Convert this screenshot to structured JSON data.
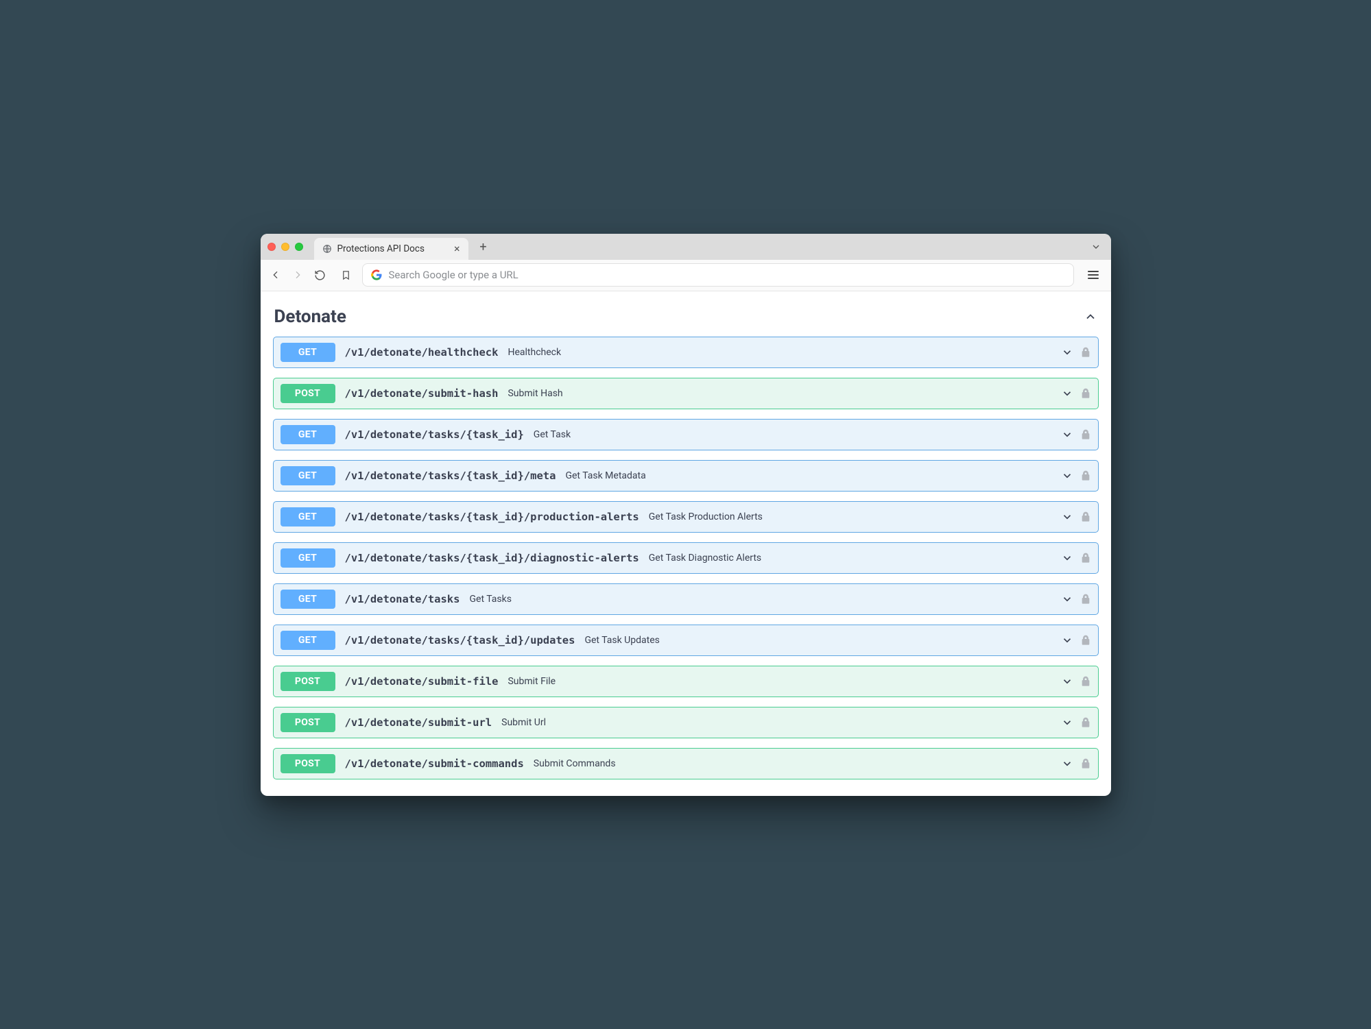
{
  "browser": {
    "tab_title": "Protections API Docs",
    "url_placeholder": "Search Google or type a URL"
  },
  "section": {
    "title": "Detonate"
  },
  "endpoints": [
    {
      "method": "GET",
      "path": "/v1/detonate/healthcheck",
      "summary": "Healthcheck"
    },
    {
      "method": "POST",
      "path": "/v1/detonate/submit-hash",
      "summary": "Submit Hash"
    },
    {
      "method": "GET",
      "path": "/v1/detonate/tasks/{task_id}",
      "summary": "Get Task"
    },
    {
      "method": "GET",
      "path": "/v1/detonate/tasks/{task_id}/meta",
      "summary": "Get Task Metadata"
    },
    {
      "method": "GET",
      "path": "/v1/detonate/tasks/{task_id}/production-alerts",
      "summary": "Get Task Production Alerts"
    },
    {
      "method": "GET",
      "path": "/v1/detonate/tasks/{task_id}/diagnostic-alerts",
      "summary": "Get Task Diagnostic Alerts"
    },
    {
      "method": "GET",
      "path": "/v1/detonate/tasks",
      "summary": "Get Tasks"
    },
    {
      "method": "GET",
      "path": "/v1/detonate/tasks/{task_id}/updates",
      "summary": "Get Task Updates"
    },
    {
      "method": "POST",
      "path": "/v1/detonate/submit-file",
      "summary": "Submit File"
    },
    {
      "method": "POST",
      "path": "/v1/detonate/submit-url",
      "summary": "Submit Url"
    },
    {
      "method": "POST",
      "path": "/v1/detonate/submit-commands",
      "summary": "Submit Commands"
    }
  ]
}
